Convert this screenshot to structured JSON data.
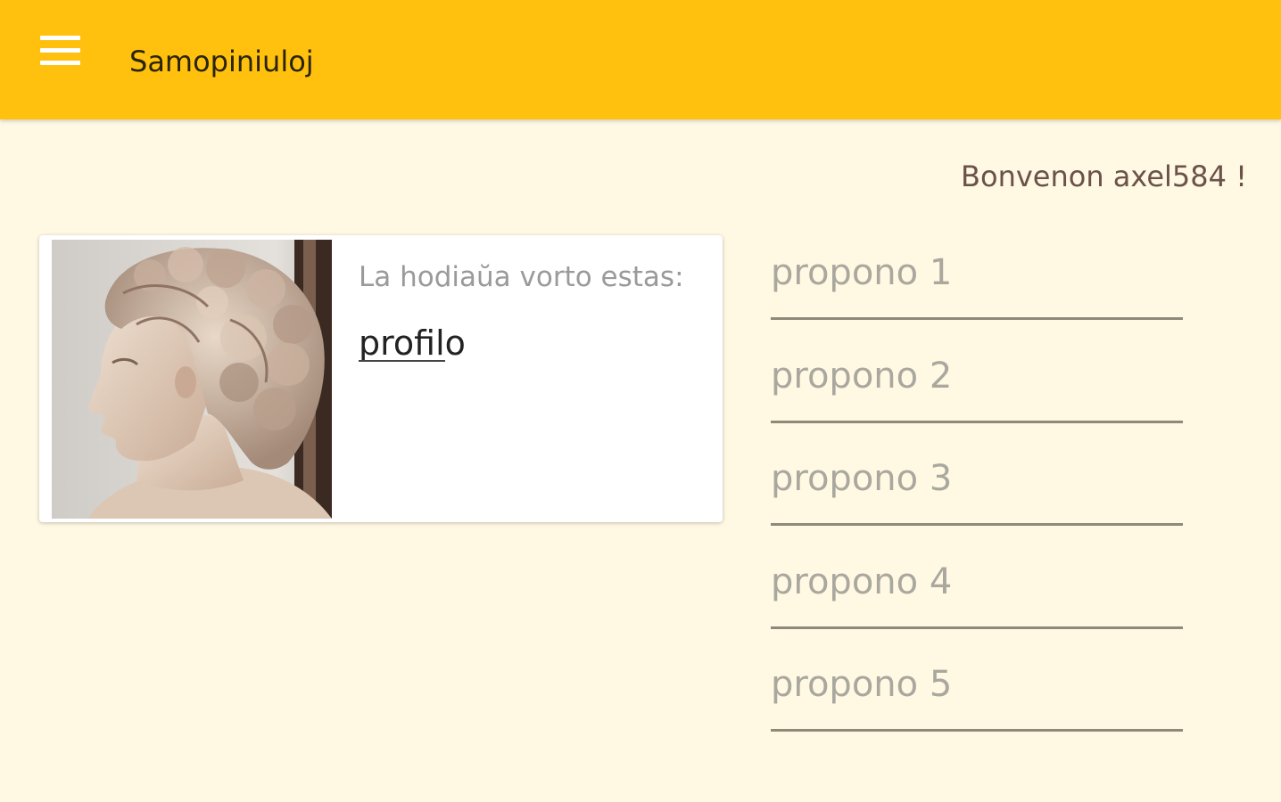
{
  "toolbar": {
    "title": "Samopiniuloj",
    "menu_icon": "hamburger-menu-icon",
    "background": "#ffc10d"
  },
  "welcome_text": "Bonvenon axel584 !",
  "card": {
    "label": "La hodiaŭa vorto estas:",
    "word": "profilo",
    "image": "marble-bust-image"
  },
  "proposals": [
    {
      "placeholder": "propono 1"
    },
    {
      "placeholder": "propono 2"
    },
    {
      "placeholder": "propono 3"
    },
    {
      "placeholder": "propono 4"
    },
    {
      "placeholder": "propono 5"
    }
  ]
}
